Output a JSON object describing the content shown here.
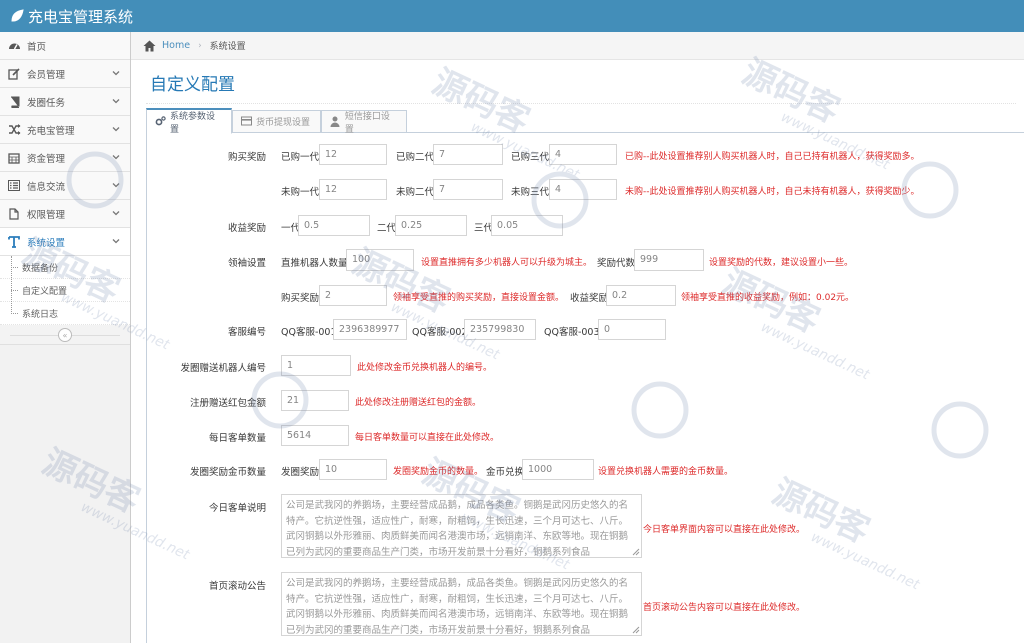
{
  "app": {
    "title": "充电宝管理系统"
  },
  "sidebar": {
    "items": [
      {
        "label": "首页",
        "icon": "dashboard-icon",
        "chevron": false
      },
      {
        "label": "会员管理",
        "icon": "edit-icon",
        "chevron": true
      },
      {
        "label": "发圈任务",
        "icon": "book-icon",
        "chevron": true
      },
      {
        "label": "充电宝管理",
        "icon": "shuffle-icon",
        "chevron": true
      },
      {
        "label": "资金管理",
        "icon": "calendar-icon",
        "chevron": true
      },
      {
        "label": "信息交流",
        "icon": "list-icon",
        "chevron": true
      },
      {
        "label": "权限管理",
        "icon": "file-icon",
        "chevron": true
      },
      {
        "label": "系统设置",
        "icon": "text-icon",
        "chevron": true,
        "active": true
      }
    ],
    "sub_items": [
      {
        "label": "数据备份"
      },
      {
        "label": "自定义配置"
      },
      {
        "label": "系统日志"
      }
    ],
    "collapse_glyph": "«"
  },
  "breadcrumb": {
    "home": "Home",
    "separator": "›",
    "current": "系统设置"
  },
  "page": {
    "title": "自定义配置"
  },
  "tabs": [
    {
      "label": "系统参数设置",
      "icon": "cogs-icon",
      "active": true
    },
    {
      "label": "货币提现设置",
      "icon": "credit-card-icon"
    },
    {
      "label": "短信接口设置",
      "icon": "user-icon"
    }
  ],
  "form": {
    "purchase_reward": {
      "label": "购买奖励",
      "row1": {
        "a_label": "已购一代",
        "a_value": "12",
        "b_label": "已购二代",
        "b_value": "7",
        "c_label": "已购三代",
        "c_value": "4",
        "help": "已购--此处设置推荐别人购买机器人时，自己已持有机器人，获得奖励多。"
      },
      "row2": {
        "a_label": "未购一代",
        "a_value": "12",
        "b_label": "未购二代",
        "b_value": "7",
        "c_label": "未购三代",
        "c_value": "4",
        "help": "未购--此处设置推荐别人购买机器人时，自己未持有机器人，获得奖励少。"
      }
    },
    "income_reward": {
      "label": "收益奖励",
      "a_label": "一代",
      "a_value": "0.5",
      "b_label": "二代",
      "b_value": "0.25",
      "c_label": "三代",
      "c_value": "0.05"
    },
    "leader": {
      "label": "领袖设置",
      "count_label": "直推机器人数量",
      "count_value": "100",
      "count_help": "设置直推拥有多少机器人可以升级为城主。",
      "gen_label": "奖励代数",
      "gen_value": "999",
      "gen_help": "设置奖励的代数，建议设置小一些。",
      "buy_label": "购买奖励",
      "buy_value": "2",
      "buy_help": "领袖享受直推的购买奖励，直接设置金额。",
      "income_label": "收益奖励",
      "income_value": "0.2",
      "income_help": "领袖享受直推的收益奖励，例如：0.02元。"
    },
    "service": {
      "label": "客服编号",
      "a_label": "QQ客服-001",
      "a_value": "2396389977",
      "b_label": "QQ客服-002",
      "b_value": "235799830",
      "c_label": "QQ客服-003",
      "c_value": "0"
    },
    "gift_robot": {
      "label": "发圈赠送机器人编号",
      "value": "1",
      "help": "此处修改金币兑换机器人的编号。"
    },
    "register_gift": {
      "label": "注册赠送红包金额",
      "value": "21",
      "help": "此处修改注册赠送红包的金额。"
    },
    "daily_orders": {
      "label": "每日客单数量",
      "value": "5614",
      "help": "每日客单数量可以直接在此处修改。"
    },
    "coins": {
      "label": "发圈奖励金币数量",
      "a_label": "发圈奖励",
      "a_value": "10",
      "a_help": "发圈奖励金币的数量。",
      "b_label": "金币兑换",
      "b_value": "1000",
      "b_help": "设置兑换机器人需要的金币数量。"
    },
    "daily_desc": {
      "label": "今日客单说明",
      "value": "公司是武我冈的养鹅场，主要经营成品鹅，成品各类鱼。铜鹅是武冈历史悠久的名特产。它抗逆性强，适应性广，耐寒，耐粗饲，生长迅速，三个月可达七、八斤。武冈铜鹅以外形雅丽、肉质鲜美而闻名港澳市场，远销南洋、东欧等地。现在铜鹅已列为武冈的重要商品生产门类，市场开发前景十分看好，铜鹅系列食品",
      "help": "今日客单界面内容可以直接在此处修改。"
    },
    "notice": {
      "label": "首页滚动公告",
      "value": "公司是武我冈的养鹅场，主要经营成品鹅，成品各类鱼。铜鹅是武冈历史悠久的名特产。它抗逆性强，适应性广，耐寒，耐粗饲，生长迅速，三个月可达七、八斤。武冈铜鹅以外形雅丽、肉质鲜美而闻名港澳市场，远销南洋、东欧等地。现在铜鹅已列为武冈的重要商品生产门类，市场开发前景十分看好，铜鹅系列食品",
      "help": "首页滚动公告内容可以直接在此处修改。"
    }
  },
  "watermark": {
    "text": "源码客",
    "url": "www.yuandd.net"
  },
  "colors": {
    "topbar": "#438eb9",
    "accent": "#2679b5",
    "help": "#dd2a2a"
  }
}
